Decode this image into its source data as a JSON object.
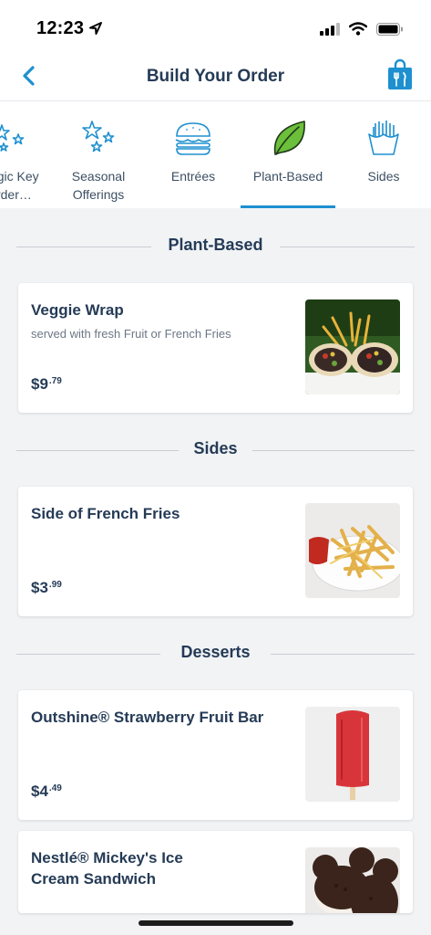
{
  "status_bar": {
    "time": "12:23"
  },
  "header": {
    "title": "Build Your Order"
  },
  "tabs": [
    {
      "label": "Magic Key Order…",
      "icon": "stars-icon"
    },
    {
      "label": "Seasonal Offerings",
      "icon": "stars-icon"
    },
    {
      "label": "Entrées",
      "icon": "burger-icon"
    },
    {
      "label": "Plant-Based",
      "icon": "leaf-icon",
      "selected": true
    },
    {
      "label": "Sides",
      "icon": "fries-icon"
    }
  ],
  "sections": {
    "plant_based": "Plant-Based",
    "sides": "Sides",
    "desserts": "Desserts"
  },
  "items": {
    "veggie_wrap": {
      "name": "Veggie Wrap",
      "description": "served with fresh Fruit or French Fries",
      "price_dollars": "$9",
      "price_cents": ".79"
    },
    "french_fries": {
      "name": "Side of French Fries",
      "price_dollars": "$3",
      "price_cents": ".99"
    },
    "fruit_bar": {
      "name": "Outshine® Strawberry Fruit Bar",
      "price_dollars": "$4",
      "price_cents": ".49"
    },
    "ice_cream_sandwich": {
      "name": "Nestlé® Mickey's Ice Cream Sandwich"
    }
  },
  "colors": {
    "accent": "#1e90d0",
    "text": "#253b56",
    "background": "#f1f3f5"
  }
}
